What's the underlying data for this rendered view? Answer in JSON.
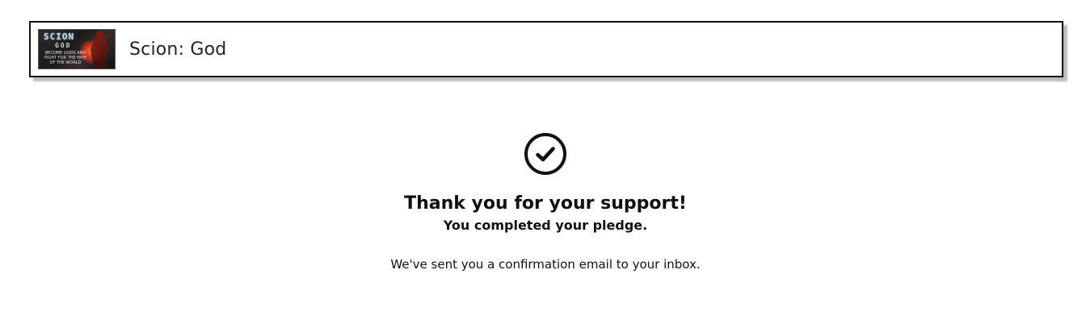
{
  "header": {
    "title": "Scion: God",
    "thumbnail": {
      "logo_text": "SCION",
      "logo_sub": "GOD",
      "tagline": "BECOME GODS AND FIGHT FOR THE FATE OF THE WORLD"
    }
  },
  "confirmation": {
    "icon": "check-circle-icon",
    "heading": "Thank you for your support!",
    "subheading": "You completed your pledge.",
    "note": "We've sent you a confirmation email to your inbox."
  }
}
